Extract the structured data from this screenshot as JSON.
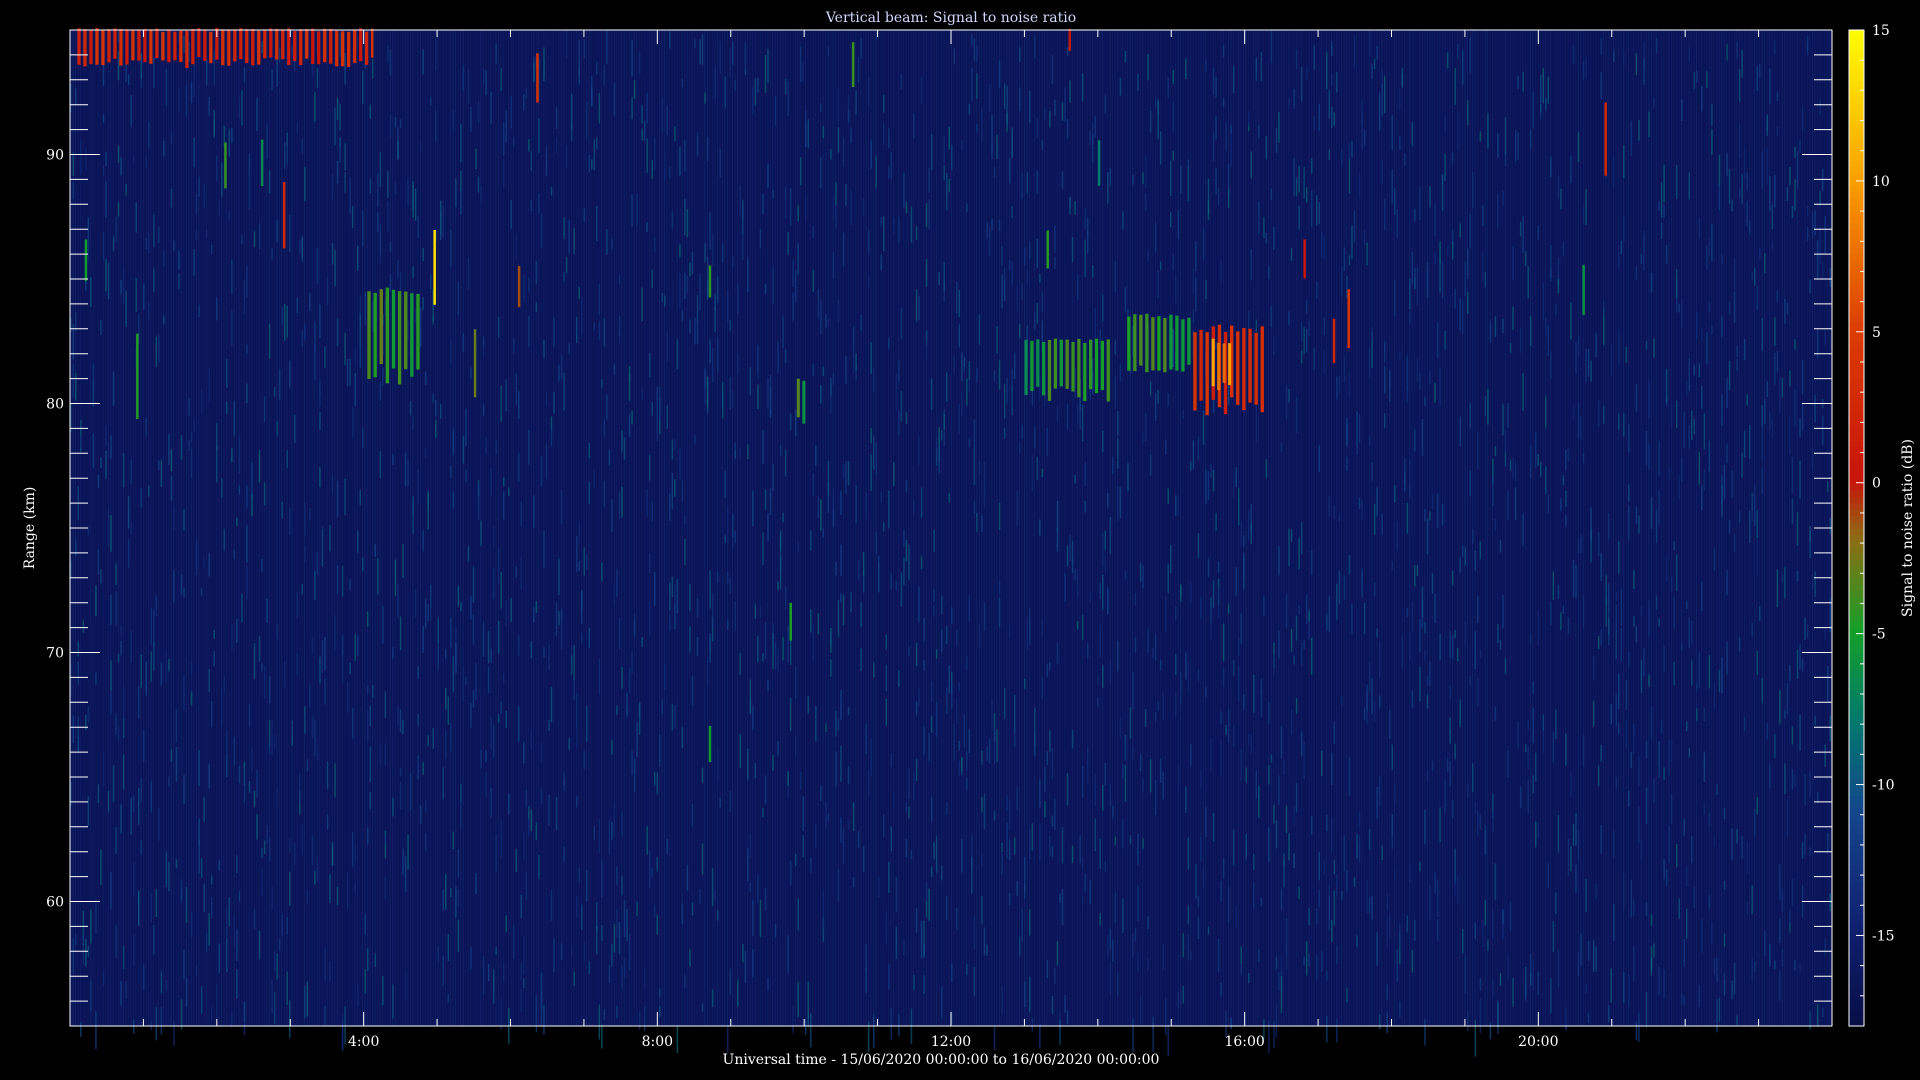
{
  "chart_data": {
    "type": "heatmap",
    "title": "Vertical beam: Signal to noise ratio",
    "xlabel": "Universal time - 15/06/2020 00:00:00 to 16/06/2020 00:00:00",
    "ylabel": "Range (km)",
    "colorbar_label": "Signal to noise ratio (dB)",
    "xlim_hours": [
      0,
      24
    ],
    "ylim_km": [
      55,
      95
    ],
    "clim_db": [
      -18,
      15
    ],
    "x_tick_labels": [
      {
        "hour": 4,
        "label": "4:00"
      },
      {
        "hour": 8,
        "label": "8:00"
      },
      {
        "hour": 12,
        "label": "12:00"
      },
      {
        "hour": 16,
        "label": "16:00"
      },
      {
        "hour": 20,
        "label": "20:00"
      }
    ],
    "y_tick_labels": [
      {
        "km": 60,
        "label": "60"
      },
      {
        "km": 70,
        "label": "70"
      },
      {
        "km": 80,
        "label": "80"
      },
      {
        "km": 90,
        "label": "90"
      }
    ],
    "colorbar_ticks": [
      {
        "db": 15,
        "label": "15"
      },
      {
        "db": 10,
        "label": "10"
      },
      {
        "db": 5,
        "label": "5"
      },
      {
        "db": 0,
        "label": "0"
      },
      {
        "db": -5,
        "label": "-5"
      },
      {
        "db": -10,
        "label": "-10"
      },
      {
        "db": -15,
        "label": "-15"
      }
    ],
    "background_db": -17,
    "features": [
      {
        "t0": 4.05,
        "t1": 4.8,
        "r0": 80.5,
        "r1": 84.5,
        "db": -4
      },
      {
        "t0": 13.0,
        "t1": 14.2,
        "r0": 80.0,
        "r1": 82.5,
        "db": -5
      },
      {
        "t0": 14.4,
        "t1": 15.3,
        "r0": 81.0,
        "r1": 83.5,
        "db": -4
      },
      {
        "t0": 15.3,
        "t1": 16.3,
        "r0": 79.5,
        "r1": 83.0,
        "db": 3
      },
      {
        "t0": 15.55,
        "t1": 15.85,
        "r0": 80.5,
        "r1": 82.5,
        "db": 9
      },
      {
        "t0": 9.9,
        "t1": 10.05,
        "r0": 79.0,
        "r1": 81.0,
        "db": -5
      },
      {
        "t0": 4.95,
        "t1": 5.0,
        "r0": 83.0,
        "r1": 87.0,
        "db": 13
      },
      {
        "t0": 2.9,
        "t1": 2.95,
        "r0": 86.0,
        "r1": 89.0,
        "db": 1
      },
      {
        "t0": 6.35,
        "t1": 6.4,
        "r0": 91.5,
        "r1": 94.0,
        "db": 2
      },
      {
        "t0": 0.2,
        "t1": 0.25,
        "r0": 84.5,
        "r1": 86.5,
        "db": -6
      },
      {
        "t0": 0.9,
        "t1": 0.95,
        "r0": 78.5,
        "r1": 83.0,
        "db": -5
      },
      {
        "t0": 2.1,
        "t1": 2.15,
        "r0": 88.5,
        "r1": 90.5,
        "db": -6
      },
      {
        "t0": 2.6,
        "t1": 2.65,
        "r0": 88.5,
        "r1": 90.5,
        "db": -6
      },
      {
        "t0": 5.5,
        "t1": 5.55,
        "r0": 79.5,
        "r1": 83.0,
        "db": -1
      },
      {
        "t0": 6.1,
        "t1": 6.15,
        "r0": 83.5,
        "r1": 85.5,
        "db": 0
      },
      {
        "t0": 8.7,
        "t1": 8.75,
        "r0": 84.0,
        "r1": 85.5,
        "db": -6
      },
      {
        "t0": 8.7,
        "t1": 8.75,
        "r0": 65.5,
        "r1": 67.0,
        "db": -6
      },
      {
        "t0": 9.8,
        "t1": 9.85,
        "r0": 70.0,
        "r1": 72.0,
        "db": -6
      },
      {
        "t0": 10.65,
        "t1": 10.7,
        "r0": 92.5,
        "r1": 94.5,
        "db": -6
      },
      {
        "t0": 13.3,
        "t1": 13.35,
        "r0": 85.0,
        "r1": 87.0,
        "db": -3
      },
      {
        "t0": 13.6,
        "t1": 13.65,
        "r0": 94.0,
        "r1": 95.0,
        "db": 1
      },
      {
        "t0": 14.0,
        "t1": 14.05,
        "r0": 88.5,
        "r1": 90.5,
        "db": -6
      },
      {
        "t0": 16.8,
        "t1": 16.85,
        "r0": 84.5,
        "r1": 86.5,
        "db": 0
      },
      {
        "t0": 17.2,
        "t1": 17.25,
        "r0": 81.5,
        "r1": 83.5,
        "db": 0
      },
      {
        "t0": 17.4,
        "t1": 17.45,
        "r0": 82.0,
        "r1": 84.5,
        "db": 2
      },
      {
        "t0": 20.9,
        "t1": 20.95,
        "r0": 88.5,
        "r1": 92.0,
        "db": 1
      },
      {
        "t0": 20.6,
        "t1": 20.65,
        "r0": 83.0,
        "r1": 85.5,
        "db": -5
      },
      {
        "t0": 0.1,
        "t1": 4.1,
        "r0": 93.5,
        "r1": 95.0,
        "db": 2
      },
      {
        "t0": 4.1,
        "t1": 4.15,
        "r0": 93.5,
        "r1": 95.0,
        "db": 2
      }
    ]
  }
}
